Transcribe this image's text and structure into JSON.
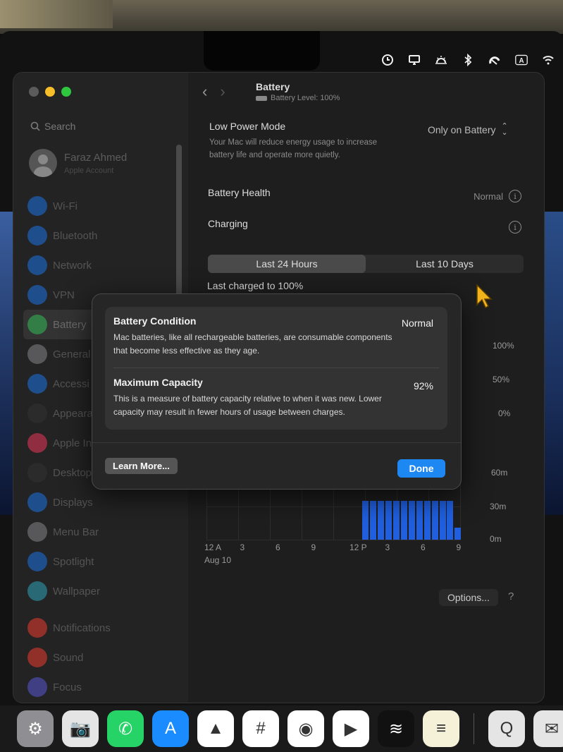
{
  "menubar": {
    "icons": [
      "screen-time-icon",
      "display-icon",
      "brightness-icon",
      "bluetooth-icon",
      "focus-icon",
      "input-source-icon",
      "wifi-icon"
    ],
    "input_source_letter": "A"
  },
  "sidebar": {
    "search_placeholder": "Search",
    "user_name": "Faraz Ahmed",
    "user_sub": "Apple Account",
    "items": [
      {
        "label": "Wi-Fi",
        "icon": "wifi-icon",
        "color": "#1a7cf5"
      },
      {
        "label": "Bluetooth",
        "icon": "bluetooth-icon",
        "color": "#1a7cf5"
      },
      {
        "label": "Network",
        "icon": "globe-icon",
        "color": "#1a7cf5"
      },
      {
        "label": "VPN",
        "icon": "globe-icon",
        "color": "#1a7cf5"
      },
      {
        "label": "Battery",
        "icon": "battery-icon",
        "color": "#34c759"
      },
      {
        "label": "General",
        "icon": "gear-icon",
        "color": "#8e8e93"
      },
      {
        "label": "Accessi",
        "icon": "accessibility-icon",
        "color": "#1a7cf5"
      },
      {
        "label": "Appeara",
        "icon": "appearance-icon",
        "color": "#333333"
      },
      {
        "label": "Apple In",
        "icon": "apple-intelligence-icon",
        "color": "#ff375f"
      },
      {
        "label": "Desktop",
        "icon": "desktop-icon",
        "color": "#333333"
      },
      {
        "label": "Displays",
        "icon": "sun-icon",
        "color": "#1a7cf5"
      },
      {
        "label": "Menu Bar",
        "icon": "menu-bar-icon",
        "color": "#8e8e93"
      },
      {
        "label": "Spotlight",
        "icon": "search-icon",
        "color": "#1a7cf5"
      },
      {
        "label": "Wallpaper",
        "icon": "wallpaper-icon",
        "color": "#30b0c7"
      },
      {
        "label": "Notifications",
        "icon": "bell-icon",
        "color": "#ff3b30"
      },
      {
        "label": "Sound",
        "icon": "speaker-icon",
        "color": "#ff3b30"
      },
      {
        "label": "Focus",
        "icon": "moon-icon",
        "color": "#5e5ce6"
      }
    ]
  },
  "main": {
    "title": "Battery",
    "subtitle": "Battery Level: 100%",
    "low_power_mode": {
      "label": "Low Power Mode",
      "description": "Your Mac will reduce energy usage to increase battery life and operate more quietly.",
      "value": "Only on Battery"
    },
    "battery_health": {
      "label": "Battery Health",
      "value": "Normal"
    },
    "charging": {
      "label": "Charging"
    },
    "tabs": [
      "Last 24 Hours",
      "Last 10 Days"
    ],
    "last_charged": "Last charged to 100%",
    "options_label": "Options...",
    "help_label": "?"
  },
  "chart_data": {
    "type": "bar",
    "level_axis_labels": [
      "100%",
      "50%",
      "0%"
    ],
    "usage_axis_labels": [
      "60m",
      "30m",
      "0m"
    ],
    "x_tick_labels": [
      "12 A",
      "3",
      "6",
      "9",
      "12 P",
      "3",
      "6",
      "9"
    ],
    "date_label": "Aug 10",
    "usage_ylim": [
      0,
      60
    ],
    "usage_values": [
      0,
      0,
      0,
      0,
      0,
      0,
      0,
      0,
      0,
      0,
      0,
      0,
      0,
      0,
      0,
      0,
      0,
      0,
      0,
      0,
      35,
      35,
      35,
      35,
      35,
      35,
      35,
      35,
      35,
      35,
      35,
      35,
      11
    ],
    "bar_color": "#1f5fe0"
  },
  "sheet": {
    "condition_title": "Battery Condition",
    "condition_value": "Normal",
    "condition_desc": "Mac batteries, like all rechargeable batteries, are consumable components that become less effective as they age.",
    "capacity_title": "Maximum Capacity",
    "capacity_value": "92%",
    "capacity_desc": "This is a measure of battery capacity relative to when it was new. Lower capacity may result in fewer hours of usage between charges.",
    "learn_more": "Learn More...",
    "done": "Done"
  },
  "dock": [
    {
      "name": "system-settings-icon",
      "color": "#8e8e93",
      "glyph": "⚙"
    },
    {
      "name": "screenshot-icon",
      "color": "#e5e5e5",
      "glyph": "📷"
    },
    {
      "name": "whatsapp-icon",
      "color": "#25d366",
      "glyph": "✆"
    },
    {
      "name": "app-store-icon",
      "color": "#1a8cff",
      "glyph": "A"
    },
    {
      "name": "clickup-icon",
      "color": "#ffffff",
      "glyph": "▲"
    },
    {
      "name": "slack-icon",
      "color": "#ffffff",
      "glyph": "#"
    },
    {
      "name": "chrome-icon",
      "color": "#ffffff",
      "glyph": "◉"
    },
    {
      "name": "youtube-icon",
      "color": "#ffffff",
      "glyph": "▶"
    },
    {
      "name": "spotify-icon",
      "color": "#111111",
      "glyph": "≋"
    },
    {
      "name": "notes-icon",
      "color": "#f5f0d8",
      "glyph": "≡"
    },
    {
      "name": "quicktime-icon",
      "color": "#e5e5e5",
      "glyph": "Q"
    },
    {
      "name": "mail-icon",
      "color": "#e5e5e5",
      "glyph": "✉"
    }
  ]
}
